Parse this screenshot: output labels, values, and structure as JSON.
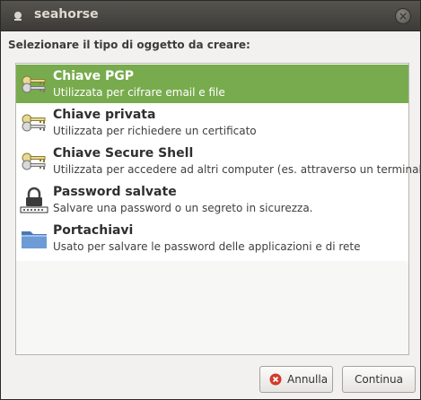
{
  "window": {
    "title": "seahorse",
    "close_glyph": "×"
  },
  "prompt": "Selezionare il tipo di oggetto da creare:",
  "items": [
    {
      "title": "Chiave PGP",
      "description": "Utilizzata per cifrare email e file",
      "icon": "keys-icon",
      "selected": true
    },
    {
      "title": "Chiave privata",
      "description": "Utilizzata per richiedere un certificato",
      "icon": "keys-icon",
      "selected": false
    },
    {
      "title": "Chiave Secure Shell",
      "description": "Utilizzata per accedere ad altri computer (es. attraverso un terminale)",
      "icon": "keys-icon",
      "selected": false
    },
    {
      "title": "Password salvate",
      "description": "Salvare una password o un segreto in sicurezza.",
      "icon": "padlock-password-icon",
      "selected": false
    },
    {
      "title": "Portachiavi",
      "description": "Usato per salvare le password delle applicazioni e di rete",
      "icon": "folder-icon",
      "selected": false
    }
  ],
  "buttons": {
    "cancel": "Annulla",
    "continue": "Continua"
  },
  "colors": {
    "selection": "#78ab4d",
    "titlebar": "#3d3b37"
  }
}
